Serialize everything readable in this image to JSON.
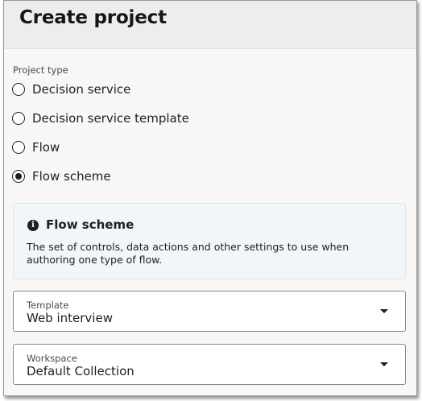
{
  "dialog": {
    "title": "Create project"
  },
  "project_type": {
    "label": "Project type",
    "options": [
      {
        "label": "Decision service",
        "selected": false
      },
      {
        "label": "Decision service template",
        "selected": false
      },
      {
        "label": "Flow",
        "selected": false
      },
      {
        "label": "Flow scheme",
        "selected": true
      }
    ]
  },
  "info": {
    "icon": "info-icon",
    "title": "Flow scheme",
    "body": "The set of controls, data actions and other settings to use when authoring one type of flow."
  },
  "template": {
    "label": "Template",
    "value": "Web interview"
  },
  "workspace": {
    "label": "Workspace",
    "value": "Default Collection"
  },
  "colors": {
    "panel_background": "#f8f7f6",
    "header_background": "#eeedeb",
    "info_background": "#f1f6fb"
  }
}
